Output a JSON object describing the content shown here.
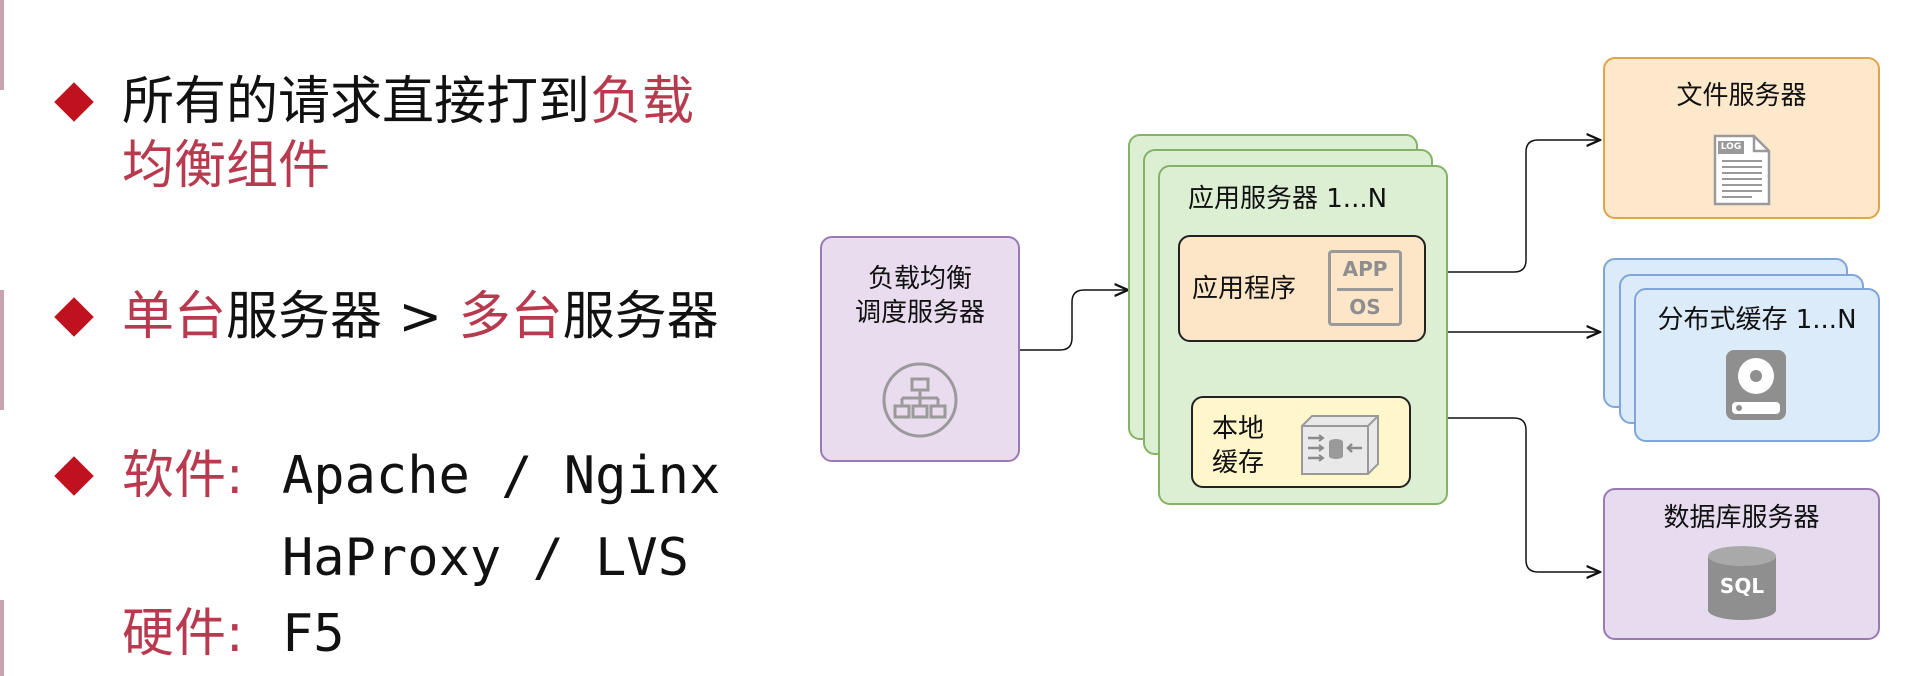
{
  "bullets": {
    "b1": {
      "line1_plain": "所有的请求直接打到",
      "line1_red": "负载",
      "line2_red": "均衡组件"
    },
    "b2": {
      "red1": "单台",
      "plain1": "服务器 > ",
      "red2": "多台",
      "plain2": "服务器"
    },
    "b3": {
      "sw_label": "软件:",
      "sw_line1": "Apache / Nginx",
      "sw_line2": "HaProxy / LVS",
      "hw_label": "硬件:",
      "hw_value": "F5"
    }
  },
  "diagram": {
    "lb": {
      "line1": "负载均衡",
      "line2": "调度服务器",
      "icon": "sitemap-icon"
    },
    "app_servers": {
      "title": "应用服务器 1...N"
    },
    "app_program": {
      "label": "应用程序",
      "icon_top": "APP",
      "icon_bottom": "OS"
    },
    "local_cache": {
      "line1": "本地",
      "line2": "缓存",
      "icon": "cache-icon"
    },
    "file_server": {
      "title": "文件服务器",
      "icon_text": "LOG"
    },
    "dist_cache": {
      "title": "分布式缓存 1...N",
      "icon": "hard-disk-icon"
    },
    "db_server": {
      "title": "数据库服务器",
      "icon_text": "SQL"
    }
  },
  "colors": {
    "accent_red": "#b83a4f",
    "bullet_red": "#c0111f",
    "green_fill": "#dcefd3",
    "orange_fill": "#fde8cc",
    "blue_fill": "#dcebf9",
    "purple_fill": "#e6dbef"
  }
}
